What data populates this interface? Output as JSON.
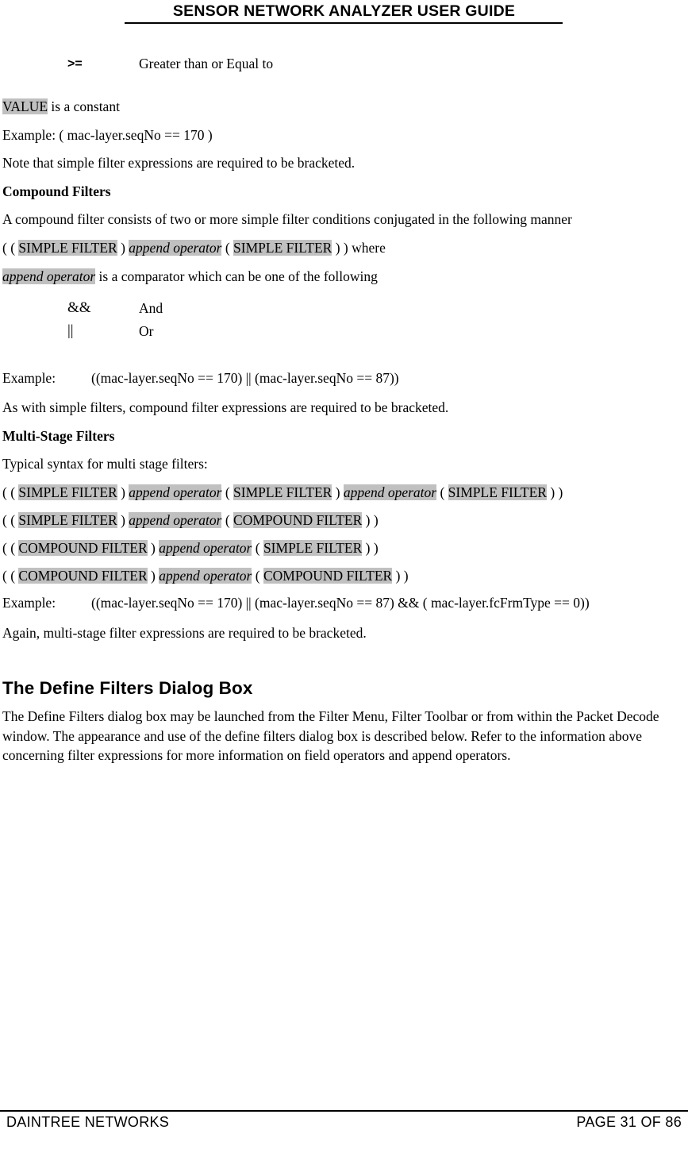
{
  "header": {
    "title": "SENSOR NETWORK ANALYZER USER GUIDE"
  },
  "footer": {
    "left": "DAINTREE NETWORKS",
    "right": "PAGE 31 OF 86"
  },
  "operator_table_top": {
    "rows": [
      {
        "op": ">=",
        "desc": "Greater than or Equal to"
      }
    ]
  },
  "body": {
    "line_value_constant_hl": "VALUE",
    "line_value_constant_rest": " is a constant",
    "line_example_simple": "Example: ( mac-layer.seqNo == 170 )",
    "line_note_bracketed": "Note that simple filter expressions are required to be bracketed.",
    "heading_compound": "Compound Filters",
    "compound_desc": "A compound filter consists of two or more simple filter conditions conjugated in the following manner",
    "compound_syntax": {
      "p1": "( ( ",
      "t1": "SIMPLE FILTER",
      "p2": " ) ",
      "t2": "append operator",
      "p3": " ( ",
      "t3": "SIMPLE FILTER",
      "p4": " ) ) where"
    },
    "append_operator_line": {
      "t1": "append operator",
      "rest": " is a comparator which can be one of the following"
    },
    "append_ops": [
      {
        "op": "&&",
        "desc": "And"
      },
      {
        "op": "||",
        "desc": "Or"
      }
    ],
    "compound_example_label": "Example:",
    "compound_example_value": "((mac-layer.seqNo == 170) || (mac-layer.seqNo == 87))",
    "compound_note": "As with simple filters, compound filter expressions are required to be bracketed.",
    "heading_multistage": "Multi-Stage Filters",
    "multistage_desc": "Typical syntax for multi stage filters:",
    "multistage_lines": [
      {
        "segments": [
          {
            "text": "( ( ",
            "style": "plain"
          },
          {
            "text": "SIMPLE FILTER",
            "style": "hl"
          },
          {
            "text": " ) ",
            "style": "plain"
          },
          {
            "text": "append operator",
            "style": "hlital"
          },
          {
            "text": " ( ",
            "style": "plain"
          },
          {
            "text": "SIMPLE FILTER",
            "style": "hl"
          },
          {
            "text": " ) ",
            "style": "plain"
          },
          {
            "text": "append operator",
            "style": "hlital"
          },
          {
            "text": " ( ",
            "style": "plain"
          },
          {
            "text": "SIMPLE FILTER",
            "style": "hl"
          },
          {
            "text": " ) )",
            "style": "plain"
          }
        ]
      },
      {
        "segments": [
          {
            "text": "( ( ",
            "style": "plain"
          },
          {
            "text": "SIMPLE FILTER",
            "style": "hl"
          },
          {
            "text": " ) ",
            "style": "plain"
          },
          {
            "text": "append operator",
            "style": "hlital"
          },
          {
            "text": " ( ",
            "style": "plain"
          },
          {
            "text": "COMPOUND FILTER",
            "style": "hl"
          },
          {
            "text": " ) )",
            "style": "plain"
          }
        ]
      },
      {
        "segments": [
          {
            "text": "( ( ",
            "style": "plain"
          },
          {
            "text": "COMPOUND FILTER",
            "style": "hl"
          },
          {
            "text": " ) ",
            "style": "plain"
          },
          {
            "text": "append operator",
            "style": "hlital"
          },
          {
            "text": " ( ",
            "style": "plain"
          },
          {
            "text": "SIMPLE FILTER",
            "style": "hl"
          },
          {
            "text": " ) )",
            "style": "plain"
          }
        ]
      },
      {
        "segments": [
          {
            "text": "( ( ",
            "style": "plain"
          },
          {
            "text": "COMPOUND FILTER",
            "style": "hl"
          },
          {
            "text": " ) ",
            "style": "plain"
          },
          {
            "text": "append operator",
            "style": "hlital"
          },
          {
            "text": " ( ",
            "style": "plain"
          },
          {
            "text": "COMPOUND FILTER",
            "style": "hl"
          },
          {
            "text": " ) )",
            "style": "plain"
          }
        ]
      }
    ],
    "multistage_example_label": "Example:",
    "multistage_example_value": "((mac-layer.seqNo == 170) || (mac-layer.seqNo == 87) && ( mac-layer.fcFrmType == 0))",
    "multistage_note": "Again, multi-stage filter expressions are required to be bracketed.",
    "heading_dialog": "The Define Filters Dialog Box",
    "dialog_para": "The Define Filters dialog box may be launched from the Filter Menu, Filter Toolbar or from within the Packet Decode window.  The appearance and use of the define filters dialog box is described below.  Refer to the information above concerning filter expressions for more information on field operators and append operators."
  },
  "colors": {
    "highlight": "#c0c0c0",
    "text": "#000000",
    "background": "#ffffff"
  }
}
